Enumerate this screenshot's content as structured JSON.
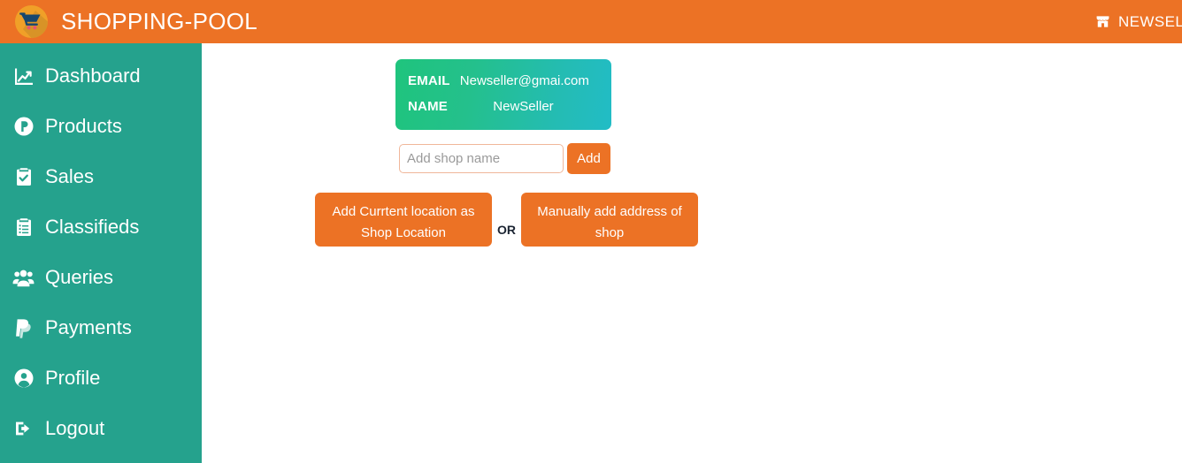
{
  "theme": {
    "brand_orange": "#ec7225",
    "sidebar_teal": "#25a28d",
    "card_gradient_from": "#1fc47d",
    "card_gradient_to": "#22bcc6",
    "input_border": "#f0b79a",
    "page_background": "#ffffff"
  },
  "header": {
    "brand_title": "SHOPPING-POOL",
    "logo_icon": "shopping-cart-logo-icon",
    "user_icon": "store-icon",
    "user_name": "NEWSELLER"
  },
  "sidebar": {
    "items": [
      {
        "label": "Dashboard",
        "icon": "chart-line-icon"
      },
      {
        "label": "Products",
        "icon": "circle-p-icon"
      },
      {
        "label": "Sales",
        "icon": "clipboard-check-icon"
      },
      {
        "label": "Classifieds",
        "icon": "clipboard-list-icon"
      },
      {
        "label": "Queries",
        "icon": "users-group-icon"
      },
      {
        "label": "Payments",
        "icon": "paypal-icon"
      },
      {
        "label": "Profile",
        "icon": "user-circle-icon"
      },
      {
        "label": "Logout",
        "icon": "sign-out-icon"
      }
    ]
  },
  "main": {
    "info_card": {
      "email_key": "EMAIL",
      "email_value": "Newseller@gmai.com",
      "name_key": "NAME",
      "name_value": "NewSeller"
    },
    "shop_form": {
      "input_value": "",
      "input_placeholder": "Add shop name",
      "add_label": "Add"
    },
    "location": {
      "current_label": "Add Currtent location as Shop Location",
      "or_label": "OR",
      "manual_label": "Manually add address of shop"
    }
  }
}
